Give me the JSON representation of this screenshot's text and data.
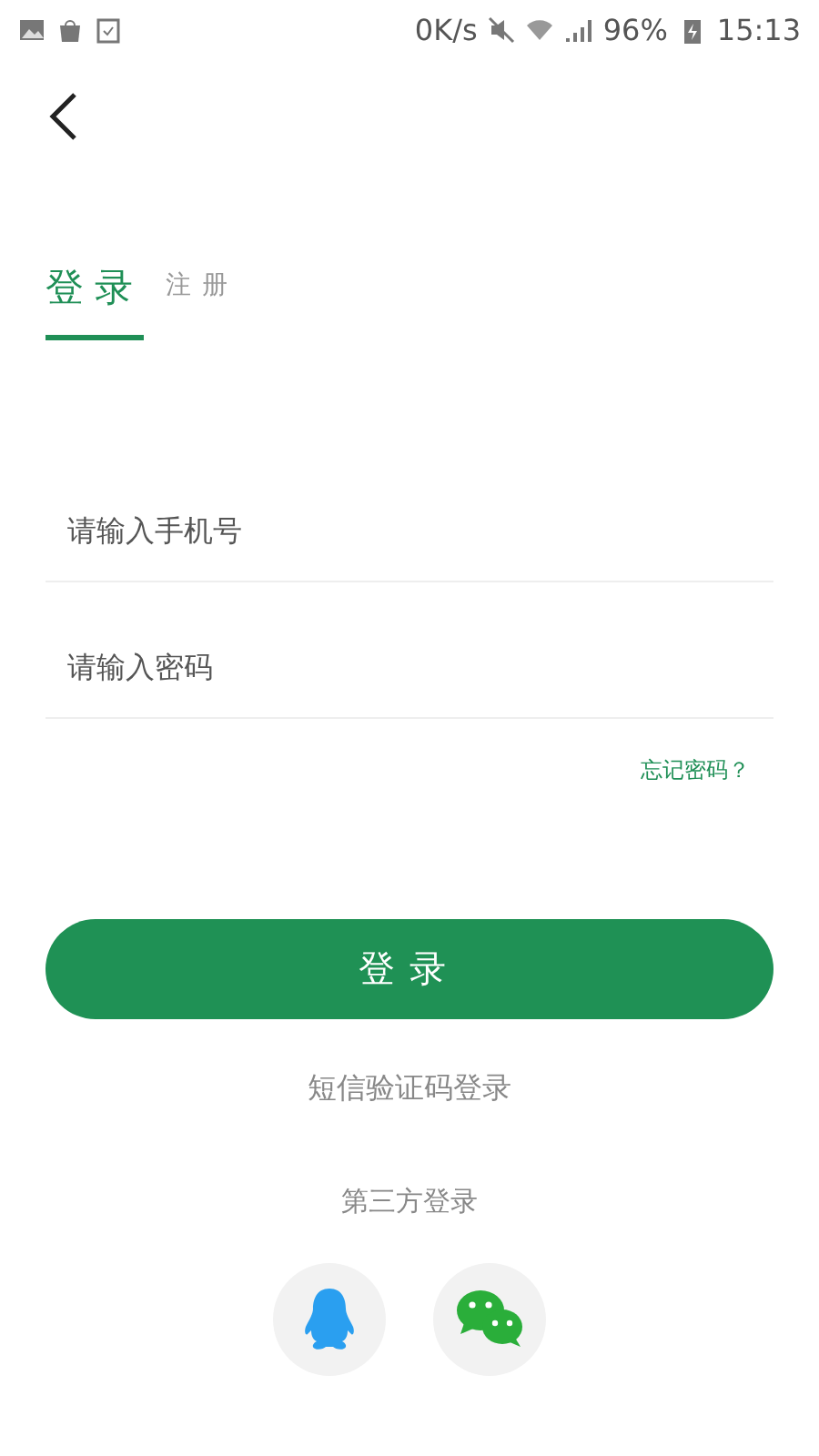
{
  "status_bar": {
    "speed": "0K/s",
    "battery": "96%",
    "time": "15:13"
  },
  "tabs": [
    {
      "label": "登录",
      "selected": true
    },
    {
      "label": "注册",
      "selected": false
    }
  ],
  "fields": [
    {
      "placeholder": "请输入手机号"
    },
    {
      "placeholder": "请输入密码"
    }
  ],
  "forgot_link": "忘记密码？",
  "login_button": "登录",
  "sms_login_link": "短信验证码登录",
  "third_party_label": "第三方登录",
  "third_party": [
    {
      "kind": "qq"
    },
    {
      "kind": "wechat"
    }
  ]
}
